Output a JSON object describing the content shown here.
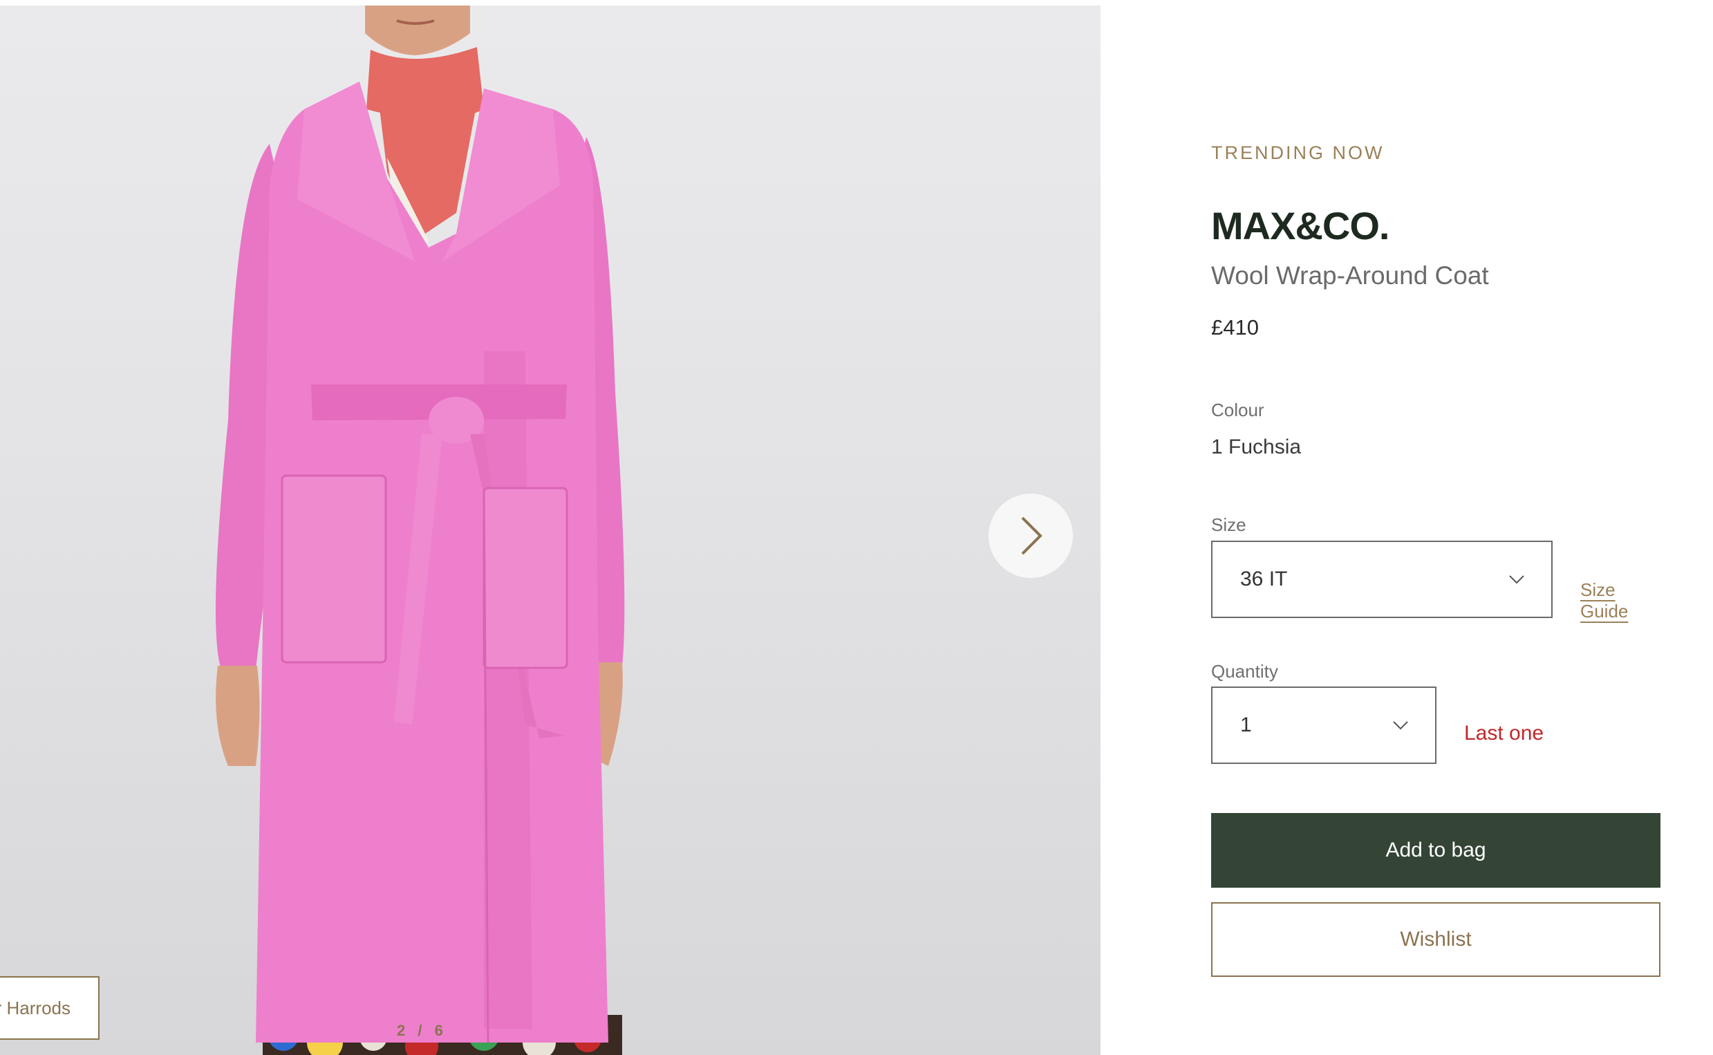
{
  "gallery": {
    "image_alt": "Model wearing pink wool wrap-around coat with belt over red turtleneck and floral skirt",
    "counter": "2 / 6",
    "store_tag": "r Harrods",
    "next_icon": "chevron-right-icon"
  },
  "product": {
    "badge": "TRENDING NOW",
    "brand": "MAX&CO.",
    "name": "Wool Wrap-Around Coat",
    "price": "£410",
    "colour_label": "Colour",
    "colour_value": "1 Fuchsia",
    "size_label": "Size",
    "size_value": "36 IT",
    "size_guide": "Size Guide",
    "quantity_label": "Quantity",
    "quantity_value": "1",
    "stock_note": "Last one",
    "add_to_bag": "Add to bag",
    "wishlist": "Wishlist"
  },
  "colors": {
    "accent_gold": "#8b7350",
    "primary_button": "#354535",
    "stock_warning": "#c0282b",
    "coat_pink": "#ec7fcb"
  }
}
